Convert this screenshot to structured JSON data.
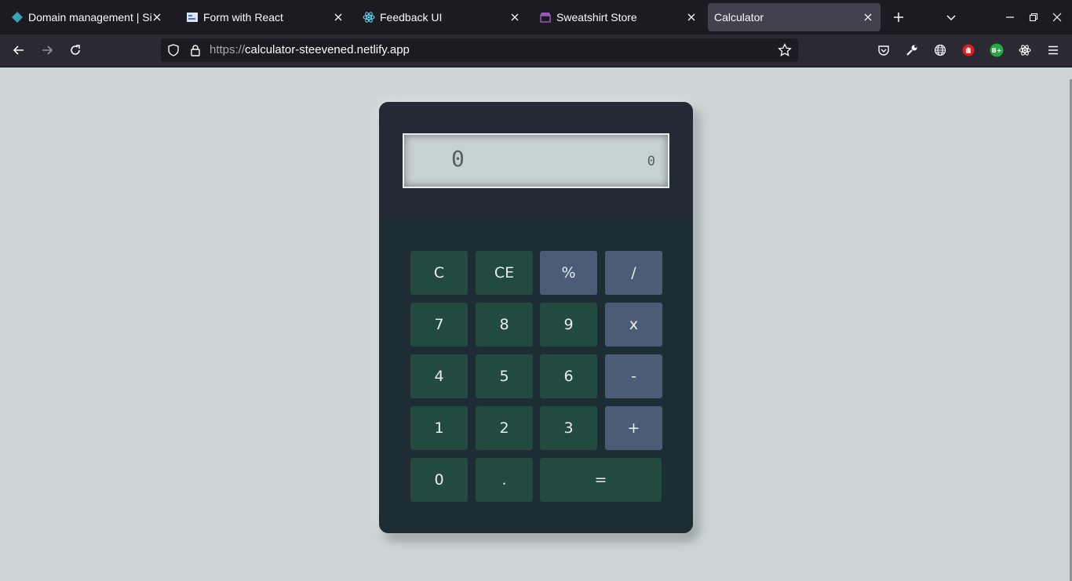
{
  "browser": {
    "tabs": [
      {
        "title": "Domain management | Si",
        "icon": "diamond-icon",
        "active": false
      },
      {
        "title": "Form with React",
        "icon": "form-icon",
        "active": false
      },
      {
        "title": "Feedback UI",
        "icon": "react-icon",
        "active": false
      },
      {
        "title": "Sweatshirt Store",
        "icon": "store-icon",
        "active": false
      },
      {
        "title": "Calculator",
        "icon": "page-icon",
        "active": true
      }
    ],
    "url_scheme": "https://",
    "url_host": "calculator-steevened.netlify.app",
    "extension_badge": "B+"
  },
  "calculator": {
    "display_current": "0",
    "display_previous": "0",
    "keys": [
      {
        "label": "C",
        "kind": "num"
      },
      {
        "label": "CE",
        "kind": "num"
      },
      {
        "label": "%",
        "kind": "op"
      },
      {
        "label": "/",
        "kind": "op"
      },
      {
        "label": "7",
        "kind": "num"
      },
      {
        "label": "8",
        "kind": "num"
      },
      {
        "label": "9",
        "kind": "num"
      },
      {
        "label": "x",
        "kind": "op"
      },
      {
        "label": "4",
        "kind": "num"
      },
      {
        "label": "5",
        "kind": "num"
      },
      {
        "label": "6",
        "kind": "num"
      },
      {
        "label": "-",
        "kind": "op"
      },
      {
        "label": "1",
        "kind": "num"
      },
      {
        "label": "2",
        "kind": "num"
      },
      {
        "label": "3",
        "kind": "num"
      },
      {
        "label": "+",
        "kind": "op"
      },
      {
        "label": "0",
        "kind": "num"
      },
      {
        "label": ".",
        "kind": "num"
      },
      {
        "label": "=",
        "kind": "num"
      }
    ]
  },
  "colors": {
    "page_bg": "#cdd5d8",
    "calc_body": "#202a34",
    "number_key": "#234a40",
    "operator_key": "#4c5c77",
    "screen": "#c6d1d1"
  }
}
